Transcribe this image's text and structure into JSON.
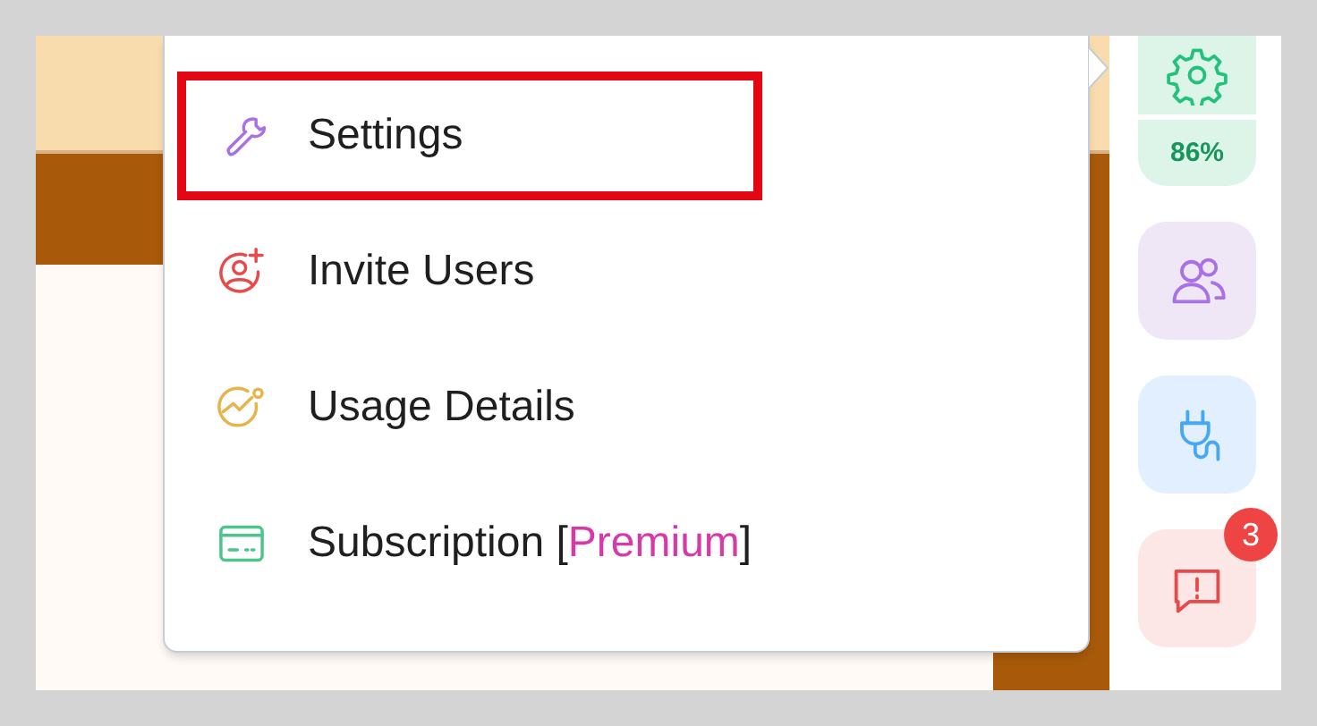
{
  "menu": {
    "items": [
      {
        "kind": "wrench",
        "label": "Settings",
        "selected": true
      },
      {
        "kind": "user-plus",
        "label": "Invite Users",
        "selected": false
      },
      {
        "kind": "chart",
        "label": "Usage Details",
        "selected": false
      },
      {
        "kind": "card",
        "label": "Subscription [",
        "tag": "Premium",
        "label_end": "]",
        "selected": false
      }
    ]
  },
  "sidebar": {
    "items": [
      {
        "kind": "gear",
        "reading": "86%"
      },
      {
        "kind": "users"
      },
      {
        "kind": "plug"
      },
      {
        "kind": "alert",
        "badge": "3"
      }
    ]
  }
}
